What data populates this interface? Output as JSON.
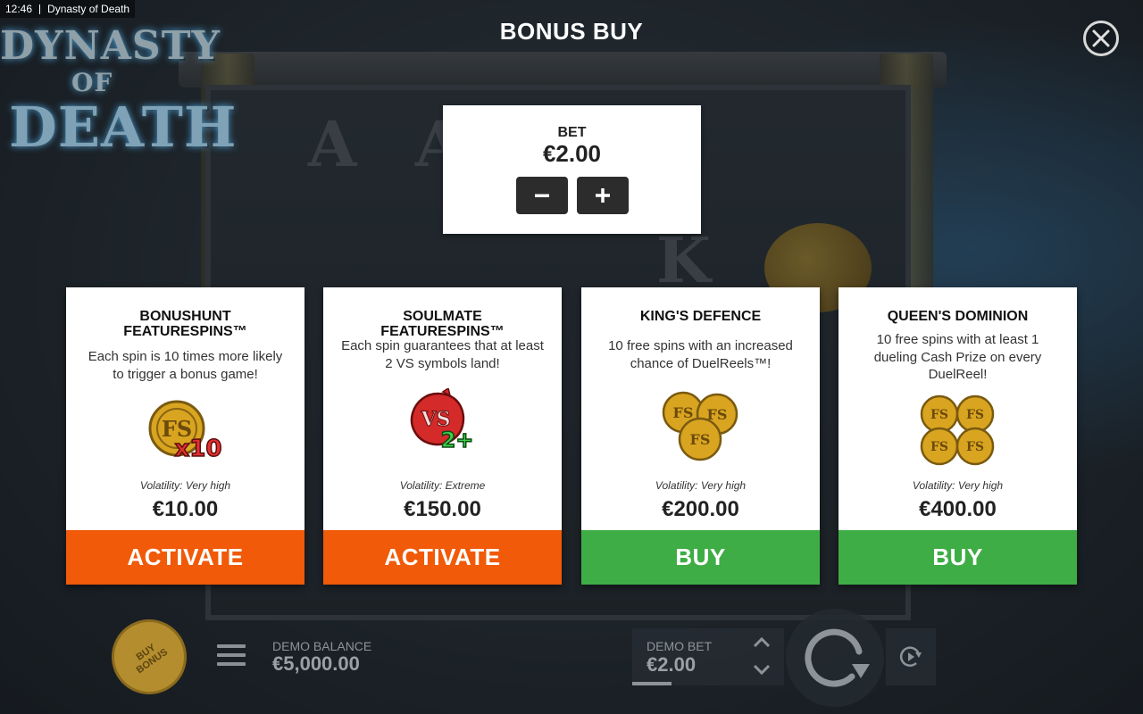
{
  "status_bar": {
    "time": "12:46",
    "app_name": "Dynasty of Death"
  },
  "logo": {
    "line1": "DYNASTY",
    "line2": "OF",
    "line3": "DEATH"
  },
  "header": {
    "title": "BONUS BUY",
    "close_icon": "close-icon"
  },
  "bet_panel": {
    "label": "BET",
    "value": "€2.00",
    "decrease_icon": "minus-icon",
    "increase_icon": "plus-icon"
  },
  "cards": [
    {
      "title": "BONUSHUNT FEATURESPINS™",
      "description": "Each spin is 10 times more likely to trigger a bonus game!",
      "icon": "fs-coin-x10-icon",
      "volatility": "Volatility: Very high",
      "price": "€10.00",
      "button": "ACTIVATE",
      "button_color": "#f05a08"
    },
    {
      "title": "SOULMATE FEATURESPINS™",
      "description": "Each spin guarantees that at least 2 VS symbols land!",
      "icon": "vs-symbol-2plus-icon",
      "volatility": "Volatility: Extreme",
      "price": "€150.00",
      "button": "ACTIVATE",
      "button_color": "#f05a08"
    },
    {
      "title": "KING'S DEFENCE",
      "description": "10 free spins with an increased chance of DuelReels™!",
      "icon": "three-fs-coins-icon",
      "volatility": "Volatility: Very high",
      "price": "€200.00",
      "button": "BUY",
      "button_color": "#3fad46"
    },
    {
      "title": "QUEEN'S DOMINION",
      "description": "10 free spins with at least 1 dueling Cash Prize on every DuelReel!",
      "icon": "four-fs-coins-icon",
      "volatility": "Volatility: Very high",
      "price": "€400.00",
      "button": "BUY",
      "button_color": "#3fad46"
    }
  ],
  "bottom_bar": {
    "buy_bonus": "BUY BONUS",
    "menu_icon": "hamburger-menu-icon",
    "balance_label": "DEMO BALANCE",
    "balance_value": "€5,000.00",
    "bet_label": "DEMO BET",
    "bet_value": "€2.00",
    "spin_icon": "spin-icon",
    "autoplay_icon": "autoplay-icon"
  }
}
